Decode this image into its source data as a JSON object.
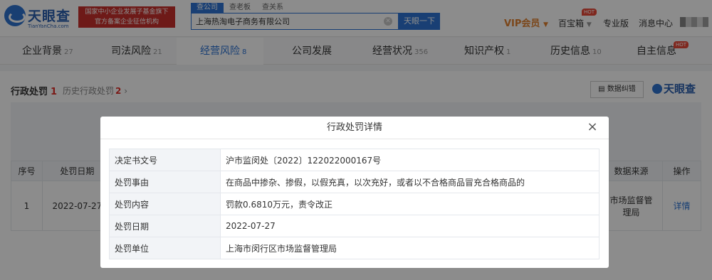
{
  "header": {
    "logo_text": "天眼查",
    "logo_sub": "TianYanCha.com",
    "gov_badge_line1": "国家中小企业发展子基金旗下",
    "gov_badge_line2": "官方备案企业征信机构",
    "search_tabs": [
      "查公司",
      "查老板",
      "查关系"
    ],
    "search_value": "上海热淘电子商务有限公司",
    "search_button": "天眼一下",
    "vip_label": "VIP会员",
    "treasure_label": "百宝箱",
    "hot_badge": "HOT",
    "pro_label": "专业版",
    "messages_label": "消息中心"
  },
  "tabs": [
    {
      "label": "企业背景",
      "count": "27"
    },
    {
      "label": "司法风险",
      "count": "21"
    },
    {
      "label": "经营风险",
      "count": "8"
    },
    {
      "label": "公司发展",
      "count": ""
    },
    {
      "label": "经营状况",
      "count": "356"
    },
    {
      "label": "知识产权",
      "count": "1"
    },
    {
      "label": "历史信息",
      "count": "10"
    },
    {
      "label": "自主信息",
      "count": ""
    }
  ],
  "content": {
    "section_title": "行政处罚",
    "section_count": "1",
    "history_label": "历史行政处罚",
    "history_count": "2",
    "report_button": "数据纠错",
    "brand": "天眼查",
    "table_headers": [
      "序号",
      "处罚日期",
      "数据来源",
      "操作"
    ],
    "row": {
      "index": "1",
      "date": "2022-07-27",
      "source_line1": "市场监督管",
      "source_line2": "理局",
      "action": "详情"
    }
  },
  "modal": {
    "title": "行政处罚详情",
    "close_icon": "×",
    "rows": [
      {
        "key": "决定书文号",
        "value": "沪市监闵处〔2022〕122022000167号"
      },
      {
        "key": "处罚事由",
        "value": "在商品中掺杂、掺假，以假充真，以次充好，或者以不合格商品冒充合格商品的"
      },
      {
        "key": "处罚内容",
        "value": "罚款0.6810万元，责令改正"
      },
      {
        "key": "处罚日期",
        "value": "2022-07-27"
      },
      {
        "key": "处罚单位",
        "value": "上海市闵行区市场监督管理局"
      }
    ]
  }
}
